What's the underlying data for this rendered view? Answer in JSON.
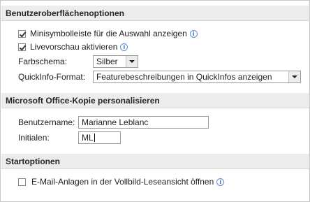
{
  "section_ui": {
    "title": "Benutzeroberflächenoptionen",
    "mini_toolbar": {
      "label": "Minisymbolleiste für die Auswahl anzeigen",
      "checked": true,
      "icon": "info-icon"
    },
    "live_preview": {
      "label": "Livevorschau aktivieren",
      "checked": true,
      "icon": "info-icon"
    },
    "color_scheme": {
      "label": "Farbschema:",
      "value": "Silber"
    },
    "screentip": {
      "label": "QuickInfo-Format:",
      "value": "Featurebeschreibungen in QuickInfos anzeigen"
    }
  },
  "section_personalize": {
    "title": "Microsoft Office-Kopie personalisieren",
    "username": {
      "label": "Benutzername:",
      "value": "Marianne Leblanc"
    },
    "initials": {
      "label": "Initialen:",
      "value": "ML"
    }
  },
  "section_start": {
    "title": "Startoptionen",
    "fullscreen_reading": {
      "label": "E-Mail-Anlagen in der Vollbild-Leseansicht öffnen",
      "checked": false,
      "icon": "info-icon"
    }
  },
  "colors": {
    "header_bg": "#ececec",
    "info_icon": "#3b72c4"
  }
}
